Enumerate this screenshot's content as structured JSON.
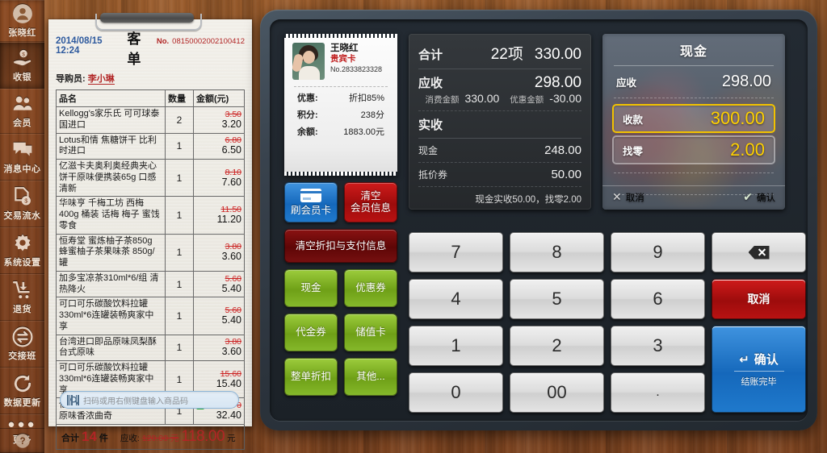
{
  "sidebar": {
    "user": {
      "name": "张晓红",
      "icon": "user-avatar-icon"
    },
    "items": [
      {
        "label": "收银",
        "icon": "cashier-hand-money-icon",
        "active": true
      },
      {
        "label": "会员",
        "icon": "members-people-icon",
        "active": false
      },
      {
        "label": "消息中心",
        "icon": "message-center-bubbles-icon",
        "active": false
      },
      {
        "label": "交易流水",
        "icon": "transaction-records-icon",
        "active": false
      },
      {
        "label": "系统设置",
        "icon": "gear-settings-icon",
        "active": false
      },
      {
        "label": "退货",
        "icon": "return-cart-icon",
        "active": false
      },
      {
        "label": "交接班",
        "icon": "shift-handover-icon",
        "active": false
      },
      {
        "label": "数据更新",
        "icon": "data-refresh-icon",
        "active": false
      },
      {
        "label": "更多",
        "icon": "more-dots-icon",
        "active": false
      }
    ],
    "help_label": "?"
  },
  "receipt": {
    "datetime": "2014/08/15 12:24",
    "title": "客单",
    "no_label": "No.",
    "no_value": "08150002002100412",
    "guide_label": "导购员:",
    "guide_name": "李小琳",
    "columns": {
      "name": "品名",
      "qty": "数量",
      "amount": "金额(元)"
    },
    "rows": [
      {
        "name": "Kellogg's家乐氏 可可球泰国进口",
        "qty": "2",
        "old": "3.50",
        "new": "3.20",
        "promo": false
      },
      {
        "name": "Lotus和情 焦糖饼干 比利时进口",
        "qty": "1",
        "old": "6.80",
        "new": "6.50",
        "promo": false
      },
      {
        "name": "亿滋卡夫奥利奥经典夹心饼干原味便携装65g 口感清新",
        "qty": "1",
        "old": "8.10",
        "new": "7.60",
        "promo": false
      },
      {
        "name": "华味亨 千梅工坊 西梅 400g 桶装 话梅 梅子 蜜饯零食",
        "qty": "1",
        "old": "11.50",
        "new": "11.20",
        "promo": false
      },
      {
        "name": "恒寿堂 蜜炼柚子茶850g 蜂蜜柚子茶果味茶 850g/罐",
        "qty": "1",
        "old": "3.80",
        "new": "3.60",
        "promo": false
      },
      {
        "name": "加多宝凉茶310ml*6/组 清热降火",
        "qty": "1",
        "old": "5.60",
        "new": "5.40",
        "promo": false
      },
      {
        "name": "可口可乐碳酸饮料拉罐330ml*6连罐装畅爽家中享",
        "qty": "1",
        "old": "5.60",
        "new": "5.40",
        "promo": false
      },
      {
        "name": "台湾进口即品原味凤梨酥 台式原味",
        "qty": "1",
        "old": "3.80",
        "new": "3.60",
        "promo": false
      },
      {
        "name": "可口可乐碳酸饮料拉罐330ml*6连罐装畅爽家中享",
        "qty": "1",
        "old": "15.60",
        "new": "15.40",
        "promo": false
      },
      {
        "name": "亿滋卡夫趣多多曲奇饼干原味香浓曲奇",
        "qty": "1",
        "old": "32.70",
        "new": "32.40",
        "promo": true,
        "promo_label": "促"
      }
    ],
    "total_label": "合计",
    "total_count": "14",
    "total_unit": "件",
    "due_label": "应收:",
    "due_old": "120.00 元",
    "due_new": "118.00",
    "due_yuan": "元",
    "scan_placeholder": "扫码或用右侧键盘输入商品码",
    "scan_icon": "barcode-scan-icon"
  },
  "member_card": {
    "photo_icon": "member-photo",
    "name": "王晓红",
    "card_type": "贵宾卡",
    "card_no": "No.2833823328",
    "rows": [
      {
        "key": "优惠:",
        "value": "折扣85%"
      },
      {
        "key": "积分:",
        "value": "238分"
      },
      {
        "key": "余额:",
        "value": "1883.00元"
      }
    ]
  },
  "summary": {
    "total_label": "合计",
    "total_items": "22项",
    "total_amount": "330.00",
    "due_label": "应收",
    "due_amount": "298.00",
    "spend_label": "消费金额",
    "spend_amount": "330.00",
    "discount_label": "优惠金额",
    "discount_amount": "-30.00",
    "received_label": "实收",
    "lines": [
      {
        "key": "现金",
        "value": "248.00"
      },
      {
        "key": "抵价券",
        "value": "50.00"
      }
    ],
    "note": "现金实收50.00，找零2.00"
  },
  "cash_panel": {
    "title": "现金",
    "due_label": "应收",
    "due_value": "298.00",
    "received_label": "收款",
    "received_value": "300.00",
    "change_label": "找零",
    "change_value": "2.00",
    "cancel_label": "取消",
    "confirm_label": "确认",
    "cancel_icon": "close-x-icon",
    "confirm_icon": "check-icon",
    "accent": "#ffd100"
  },
  "actions": [
    {
      "label": "刷会员卡",
      "style": "blue",
      "icon": "credit-card-icon",
      "name": "swipe-member-card-button"
    },
    {
      "label": "清空\n会员信息",
      "style": "red",
      "name": "clear-member-info-button"
    },
    {
      "label": "清空折扣与支付信息",
      "style": "dark-red",
      "name": "clear-discount-payment-button"
    },
    {
      "label": "现金",
      "style": "green",
      "name": "cash-button"
    },
    {
      "label": "优惠券",
      "style": "green",
      "name": "coupon-button"
    },
    {
      "label": "代金券",
      "style": "green",
      "name": "voucher-button"
    },
    {
      "label": "储值卡",
      "style": "green",
      "name": "stored-value-card-button"
    },
    {
      "label": "整单折扣",
      "style": "green",
      "name": "whole-order-discount-button"
    },
    {
      "label": "其他...",
      "style": "green",
      "name": "other-button"
    }
  ],
  "keypad": {
    "keys": [
      "7",
      "8",
      "9",
      "4",
      "5",
      "6",
      "1",
      "2",
      "3",
      "0",
      "00",
      "."
    ],
    "backspace_icon": "backspace-icon",
    "cancel_label": "取消",
    "confirm_label": "确认",
    "confirm_sub": "结账完毕",
    "enter_icon": "enter-arrow-icon"
  }
}
